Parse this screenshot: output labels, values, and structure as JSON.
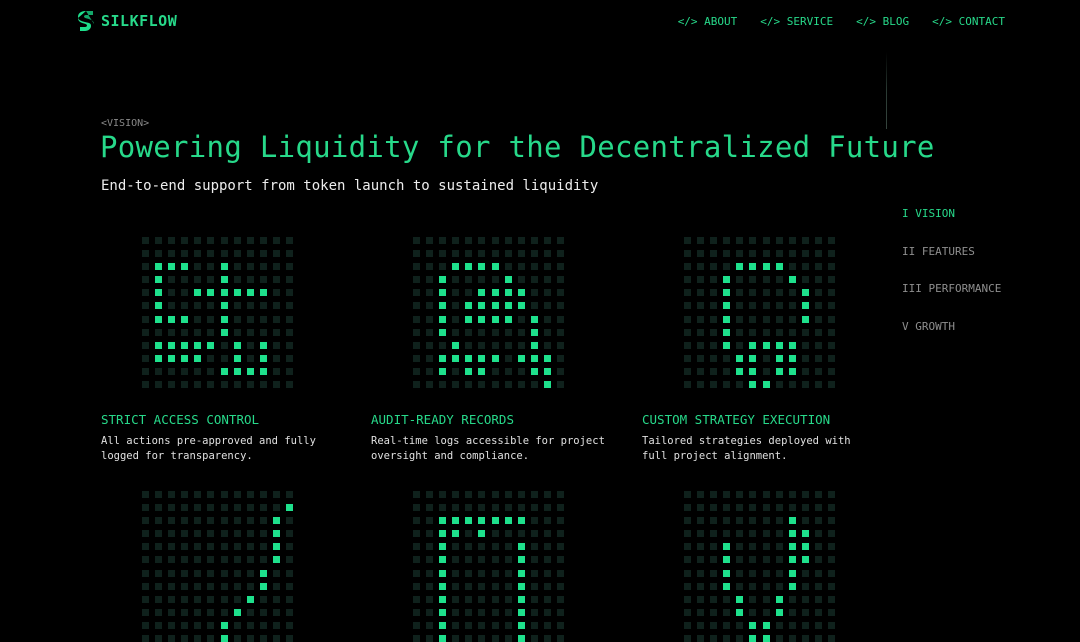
{
  "brand": {
    "name": "SILKFLOW"
  },
  "nav": {
    "items": [
      {
        "label": "</> ABOUT"
      },
      {
        "label": "</> SERVICE"
      },
      {
        "label": "</> BLOG"
      },
      {
        "label": "</> CONTACT"
      }
    ]
  },
  "hero": {
    "eyebrow": "<VISION>",
    "title": "Powering Liquidity for the Decentralized Future",
    "subtitle": "End-to-end support from token launch to sustained liquidity"
  },
  "side_nav": {
    "items": [
      {
        "label": "I VISION",
        "active": true
      },
      {
        "label": "II FEATURES",
        "active": false
      },
      {
        "label": "III PERFORMANCE",
        "active": false
      },
      {
        "label": "V GROWTH",
        "active": false
      }
    ]
  },
  "features": [
    {
      "title": "STRICT ACCESS CONTROL",
      "description": "All actions pre-approved and fully logged for transparency."
    },
    {
      "title": "AUDIT-READY RECORDS",
      "description": "Real-time logs accessible for project oversight and compliance."
    },
    {
      "title": "CUSTOM STRATEGY EXECUTION",
      "description": "Tailored strategies deployed with full project alignment."
    }
  ],
  "colors": {
    "accent": "#27d98a",
    "pixel_on": "#1ee08c",
    "pixel_off": "#0f211c",
    "background": "#000000"
  },
  "pixel_art": {
    "grid_columns": 12,
    "grid_rows": 12,
    "patterns": [
      [
        "............",
        "............",
        ".111..1.....",
        ".1....1.....",
        ".1..111111..",
        ".1....1.....",
        ".111..1.....",
        "......1.....",
        ".11111.1.1..",
        ".1111..1.1..",
        "......1111..",
        "............"
      ],
      [
        "............",
        "............",
        "...1111.....",
        "..1....1....",
        "..1..1111...",
        "..1.11111...",
        "..1.1111.1..",
        "..1......1..",
        "...1.....1..",
        "..11111.111.",
        "..1.11...11.",
        "..........1."
      ],
      [
        "............",
        "............",
        "....1111....",
        "...1....1...",
        "...1.....1..",
        "...1.....1..",
        "...1.....1..",
        "...1........",
        "...1.1111...",
        "....11.11...",
        "....11.11...",
        ".....11....."
      ],
      [
        "............",
        "...........1",
        "..........1.",
        "..........1.",
        "..........1.",
        "..........1.",
        ".........1..",
        ".........1..",
        "........1...",
        ".......1....",
        "......1.....",
        "......1....."
      ],
      [
        "............",
        "............",
        "..1111111...",
        "..11.1......",
        "..1.....1...",
        "..1.....1...",
        "..1.....1...",
        "..1.....1...",
        "..1.....1...",
        "..1.....1...",
        "..1.....1...",
        "..1.....1..."
      ],
      [
        "............",
        "............",
        "........1...",
        "........11..",
        "...1....11..",
        "...1....11..",
        "...1....1...",
        "...1....1...",
        "....1..1....",
        "....1..1....",
        ".....11.....",
        ".....11....."
      ]
    ]
  }
}
